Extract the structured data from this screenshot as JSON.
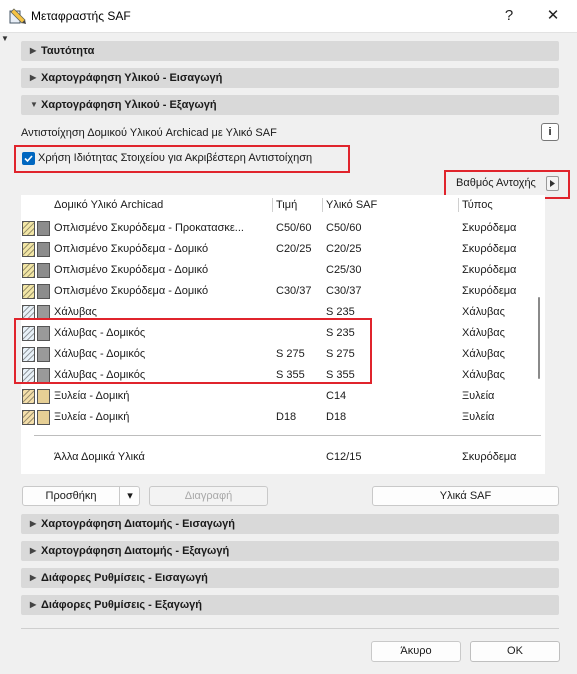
{
  "window": {
    "title": "Μεταφραστής SAF",
    "help": "?",
    "close": "✕"
  },
  "sections_top": [
    {
      "label": "Ταυτότητα",
      "state": "collapsed"
    },
    {
      "label": "Χαρτογράφηση Υλικού - Εισαγωγή",
      "state": "collapsed"
    },
    {
      "label": "Χαρτογράφηση Υλικού - Εξαγωγή",
      "state": "expanded"
    }
  ],
  "export_panel": {
    "description": "Αντιστοίχηση Δομικού Υλικού Archicad με Υλικό SAF",
    "info_icon": "i",
    "checkbox_label": "Χρήση Ιδιότητας Στοιχείου για Ακριβέστερη Αντιστοίχηση",
    "checkbox_checked": true,
    "property_button": "Βαθμός Αντοχής"
  },
  "table": {
    "columns": [
      "Δομικό Υλικό Archicad",
      "Τιμή",
      "Υλικό SAF",
      "Τύπος"
    ],
    "rows": [
      {
        "material": "Οπλισμένο Σκυρόδεμα - Προκατασκε...",
        "value": "C50/60",
        "saf": "C50/60",
        "type": "Σκυρόδεμα",
        "swatch": "concrete"
      },
      {
        "material": "Οπλισμένο Σκυρόδεμα - Δομικό",
        "value": "C20/25",
        "saf": "C20/25",
        "type": "Σκυρόδεμα",
        "swatch": "concrete"
      },
      {
        "material": "Οπλισμένο Σκυρόδεμα - Δομικό",
        "value": "",
        "saf": "C25/30",
        "type": "Σκυρόδεμα",
        "swatch": "concrete"
      },
      {
        "material": "Οπλισμένο Σκυρόδεμα - Δομικό",
        "value": "C30/37",
        "saf": "C30/37",
        "type": "Σκυρόδεμα",
        "swatch": "concrete"
      },
      {
        "material": "Χάλυβας",
        "value": "",
        "saf": "S 235",
        "type": "Χάλυβας",
        "swatch": "steel"
      },
      {
        "material": "Χάλυβας - Δομικός",
        "value": "",
        "saf": "S 235",
        "type": "Χάλυβας",
        "swatch": "steel"
      },
      {
        "material": "Χάλυβας - Δομικός",
        "value": "S 275",
        "saf": "S 275",
        "type": "Χάλυβας",
        "swatch": "steel"
      },
      {
        "material": "Χάλυβας - Δομικός",
        "value": "S 355",
        "saf": "S 355",
        "type": "Χάλυβας",
        "swatch": "steel"
      },
      {
        "material": "Ξυλεία - Δομική",
        "value": "",
        "saf": "C14",
        "type": "Ξυλεία",
        "swatch": "timber"
      },
      {
        "material": "Ξυλεία - Δομική",
        "value": "D18",
        "saf": "D18",
        "type": "Ξυλεία",
        "swatch": "timber"
      }
    ],
    "other_row": {
      "material": "Άλλα Δομικά Υλικά",
      "value": "",
      "saf": "C12/15",
      "type": "Σκυρόδεμα"
    }
  },
  "actions": {
    "add": "Προσθήκη",
    "add_menu": "▾",
    "delete": "Διαγραφή",
    "saf_materials": "Υλικά SAF"
  },
  "sections_bottom": [
    {
      "label": "Χαρτογράφηση Διατομής - Εισαγωγή"
    },
    {
      "label": "Χαρτογράφηση Διατομής - Εξαγωγή"
    },
    {
      "label": "Διάφορες Ρυθμίσεις - Εισαγωγή"
    },
    {
      "label": "Διάφορες Ρυθμίσεις - Εξαγωγή"
    }
  ],
  "footer": {
    "cancel": "Άκυρο",
    "ok": "OK"
  },
  "colors": {
    "accent": "#0067c0",
    "highlight": "#e0242c",
    "section_bg": "#d9d9d9"
  },
  "swatch_colors": {
    "concrete": {
      "hatch": "#f2e6a6",
      "solid": "#8c8c8c"
    },
    "steel": {
      "hatch": "#e8f1f8",
      "solid": "#9a9a9a"
    },
    "timber": {
      "hatch": "#f3deaa",
      "solid": "#e6cf95"
    }
  }
}
